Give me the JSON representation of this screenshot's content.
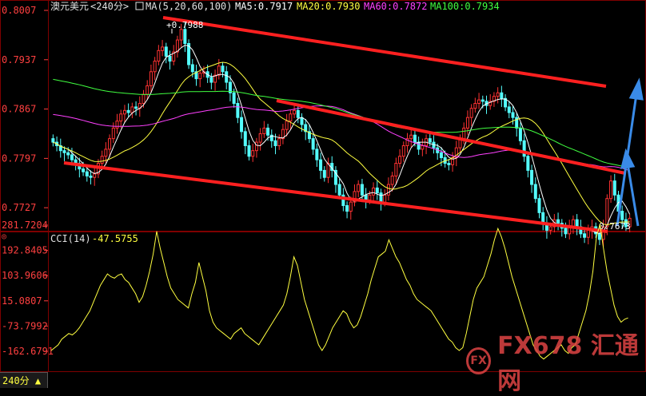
{
  "header": {
    "symbol": "澳元美元",
    "period": "<240分>",
    "ma_label": "MA(5,20,60,100)",
    "ma5": "MA5:0.7917",
    "ma20": "MA20:0.7930",
    "ma60": "MA60:0.7872",
    "ma100": "MA100:0.7934"
  },
  "cci_header": {
    "label": "CCI(14)",
    "value": "-47.5755"
  },
  "price_axis": [
    "0.8007",
    "0.7937",
    "0.7867",
    "0.7797",
    "0.7727"
  ],
  "cci_axis": [
    "281.7204",
    "192.8405",
    "103.9606",
    "15.0807",
    "-73.7992",
    "-162.6791"
  ],
  "annotations": {
    "high": "0.7988",
    "low": "0.7673"
  },
  "period_tab": "240分",
  "watermark": {
    "text": "FX678 汇通网",
    "logo": "FX"
  },
  "colors": {
    "up": "#ff3232",
    "down": "#54ffff",
    "ma5": "#ffffff",
    "ma20": "#ffff40",
    "ma60": "#ff40ff",
    "ma100": "#40ff40",
    "trendline": "#ff2020",
    "arrow": "#3a8be8",
    "cci": "#ffff40"
  },
  "chart_data": [
    {
      "type": "candlestick",
      "title": "澳元美元 <240分>",
      "ylim": [
        0.77,
        0.8007
      ],
      "series": [
        {
          "name": "MA5",
          "last": 0.7917
        },
        {
          "name": "MA20",
          "last": 0.793
        },
        {
          "name": "MA60",
          "last": 0.7872
        },
        {
          "name": "MA100",
          "last": 0.7934
        }
      ],
      "close": [
        0.782,
        0.7815,
        0.7808,
        0.7805,
        0.7802,
        0.7795,
        0.779,
        0.7782,
        0.7778,
        0.7772,
        0.777,
        0.7775,
        0.779,
        0.78,
        0.781,
        0.7825,
        0.784,
        0.785,
        0.786,
        0.7865,
        0.7862,
        0.787,
        0.7868,
        0.7875,
        0.7888,
        0.79,
        0.792,
        0.7935,
        0.795,
        0.7955,
        0.7942,
        0.7935,
        0.7948,
        0.7965,
        0.798,
        0.796,
        0.793,
        0.792,
        0.791,
        0.7918,
        0.792,
        0.7912,
        0.7905,
        0.7915,
        0.7928,
        0.792,
        0.7905,
        0.789,
        0.7875,
        0.7855,
        0.7835,
        0.7815,
        0.78,
        0.7808,
        0.782,
        0.7832,
        0.784,
        0.783,
        0.7822,
        0.7815,
        0.7825,
        0.7838,
        0.785,
        0.786,
        0.7865,
        0.7855,
        0.7845,
        0.7835,
        0.7825,
        0.781,
        0.7795,
        0.778,
        0.777,
        0.779,
        0.778,
        0.776,
        0.7745,
        0.773,
        0.7722,
        0.7735,
        0.775,
        0.776,
        0.7745,
        0.7738,
        0.7745,
        0.7755,
        0.7748,
        0.7735,
        0.7745,
        0.776,
        0.7772,
        0.779,
        0.78,
        0.7815,
        0.7825,
        0.783,
        0.782,
        0.781,
        0.7815,
        0.7825,
        0.782,
        0.7812,
        0.7805,
        0.7798,
        0.779,
        0.7788,
        0.7798,
        0.7812,
        0.7825,
        0.784,
        0.7855,
        0.7868,
        0.7875,
        0.788,
        0.7878,
        0.7872,
        0.7878,
        0.7885,
        0.789,
        0.7882,
        0.787,
        0.7862,
        0.7855,
        0.784,
        0.7822,
        0.78,
        0.778,
        0.776,
        0.774,
        0.772,
        0.7705,
        0.7695,
        0.77,
        0.771,
        0.7705,
        0.7698,
        0.769,
        0.77,
        0.771,
        0.77,
        0.769,
        0.7685,
        0.7695,
        0.77,
        0.769,
        0.7682,
        0.77,
        0.774,
        0.7765,
        0.7745,
        0.7722,
        0.771,
        0.77,
        0.7712
      ],
      "low_label": 0.7673,
      "high_label": 0.7988
    },
    {
      "type": "line",
      "title": "CCI(14)",
      "ylim": [
        -200,
        300
      ],
      "series": [
        {
          "name": "CCI(14)",
          "last": -47.5755
        }
      ],
      "values": [
        -160,
        -150,
        -140,
        -120,
        -110,
        -100,
        -105,
        -95,
        -80,
        -60,
        -40,
        -20,
        10,
        40,
        70,
        90,
        110,
        100,
        95,
        105,
        110,
        90,
        80,
        60,
        40,
        10,
        30,
        70,
        120,
        180,
        260,
        200,
        150,
        100,
        60,
        40,
        20,
        10,
        0,
        -10,
        40,
        80,
        150,
        100,
        50,
        -20,
        -60,
        -80,
        -90,
        -100,
        -110,
        -120,
        -100,
        -90,
        -80,
        -100,
        -110,
        -120,
        -130,
        -140,
        -120,
        -100,
        -80,
        -60,
        -40,
        -20,
        0,
        40,
        100,
        170,
        140,
        80,
        20,
        -20,
        -60,
        -100,
        -140,
        -160,
        -140,
        -110,
        -80,
        -60,
        -40,
        -20,
        -30,
        -60,
        -80,
        -70,
        -40,
        0,
        40,
        90,
        130,
        170,
        180,
        190,
        230,
        200,
        170,
        150,
        120,
        90,
        70,
        40,
        20,
        10,
        0,
        -10,
        -20,
        -40,
        -60,
        -80,
        -100,
        -120,
        -130,
        -150,
        -160,
        -150,
        -100,
        -40,
        20,
        60,
        80,
        100,
        140,
        180,
        230,
        270,
        240,
        200,
        150,
        100,
        60,
        20,
        -20,
        -60,
        -100,
        -140,
        -160,
        -180,
        -190,
        -180,
        -170,
        -160,
        -150,
        -140,
        -160,
        -170,
        -150,
        -140,
        -100,
        -60,
        -20,
        40,
        120,
        240,
        285,
        200,
        120,
        60,
        0,
        -40,
        -60,
        -50,
        -45
      ]
    }
  ]
}
